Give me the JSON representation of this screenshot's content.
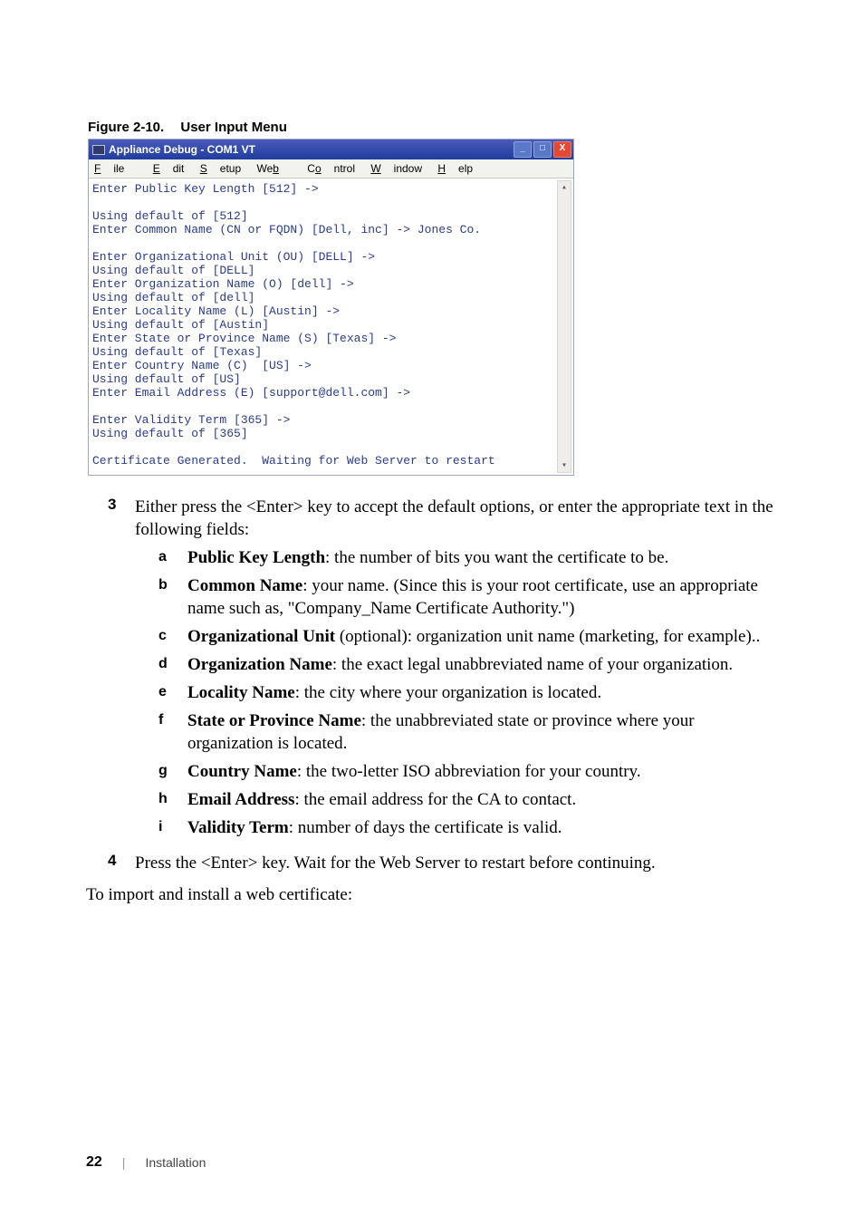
{
  "figure": {
    "label": "Figure 2-10.",
    "title": "User Input Menu"
  },
  "window": {
    "title": "Appliance Debug - COM1 VT",
    "menu": {
      "file": "File",
      "edit": "Edit",
      "setup": "Setup",
      "web": "Web",
      "control": "Control",
      "window": "Window",
      "help": "Help"
    },
    "minimize": "_",
    "maximize": "□",
    "close": "X",
    "lines": [
      "Enter Public Key Length [512] ->",
      "",
      "Using default of [512]",
      "Enter Common Name (CN or FQDN) [Dell, inc] -> Jones Co.",
      "",
      "Enter Organizational Unit (OU) [DELL] ->",
      "Using default of [DELL]",
      "Enter Organization Name (O) [dell] ->",
      "Using default of [dell]",
      "Enter Locality Name (L) [Austin] ->",
      "Using default of [Austin]",
      "Enter State or Province Name (S) [Texas] ->",
      "Using default of [Texas]",
      "Enter Country Name (C)  [US] ->",
      "Using default of [US]",
      "Enter Email Address (E) [support@dell.com] ->",
      "",
      "Enter Validity Term [365] ->",
      "Using default of [365]",
      "",
      "Certificate Generated.  Waiting for Web Server to restart"
    ]
  },
  "step3": {
    "num": "3",
    "text_a": "Either press the <Enter> key to accept the default options, or enter the appropriate text in the following fields:"
  },
  "subs": {
    "a": {
      "l": "a",
      "bold": "Public Key Length",
      "rest": ": the number of bits you want the certificate to be."
    },
    "b": {
      "l": "b",
      "bold": "Common Name",
      "rest": ": your name. (Since this is your root certificate, use an appropriate name such as, \"Company_Name Certificate Authority.\")"
    },
    "c": {
      "l": "c",
      "bold": "Organizational Unit",
      "rest": " (optional): organization unit name (marketing, for example).."
    },
    "d": {
      "l": "d",
      "bold": "Organization Name",
      "rest": ": the exact legal unabbreviated name of your organization."
    },
    "e": {
      "l": "e",
      "bold": "Locality Name",
      "rest": ": the city where your organization is located."
    },
    "f": {
      "l": "f",
      "bold": "State or Province Name",
      "rest": ": the unabbreviated state or province where your organization is located."
    },
    "g": {
      "l": "g",
      "bold": "Country Name",
      "rest": ": the two-letter ISO abbreviation for your country."
    },
    "h": {
      "l": "h",
      "bold": "Email Address",
      "rest": ": the email address for the CA to contact."
    },
    "i": {
      "l": "i",
      "bold": "Validity Term",
      "rest": ": number of days the certificate is valid."
    }
  },
  "step4": {
    "num": "4",
    "text": "Press the <Enter> key. Wait for the Web Server to restart before continuing."
  },
  "closing": "To import and install a web certificate:",
  "footer": {
    "page": "22",
    "section": "Installation"
  }
}
